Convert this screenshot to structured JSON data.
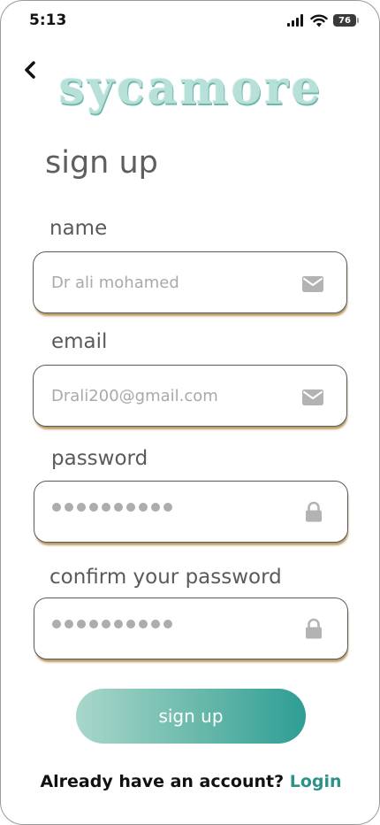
{
  "status_bar": {
    "time": "5:13",
    "battery": "76"
  },
  "brand": {
    "logo": "sycamore"
  },
  "page": {
    "title": "sign up"
  },
  "form": {
    "name_label": "name",
    "name_value": "Dr ali mohamed",
    "email_label": "email",
    "email_value": "Drali200@gmail.com",
    "password_label": "password",
    "password_length": 10,
    "confirm_label": "confirm your password",
    "confirm_length": 10
  },
  "actions": {
    "signup_label": "sign up",
    "footer_text": "Already have an account?",
    "login_label": "Login"
  },
  "icons": {
    "back": "chevron-left-icon",
    "field_mail": "envelope-icon",
    "field_lock": "lock-icon"
  },
  "colors": {
    "accent": "#2a9289",
    "button_start": "#a9d7cb",
    "button_end": "#2e9e94",
    "field_shadow": "#b89b66"
  }
}
